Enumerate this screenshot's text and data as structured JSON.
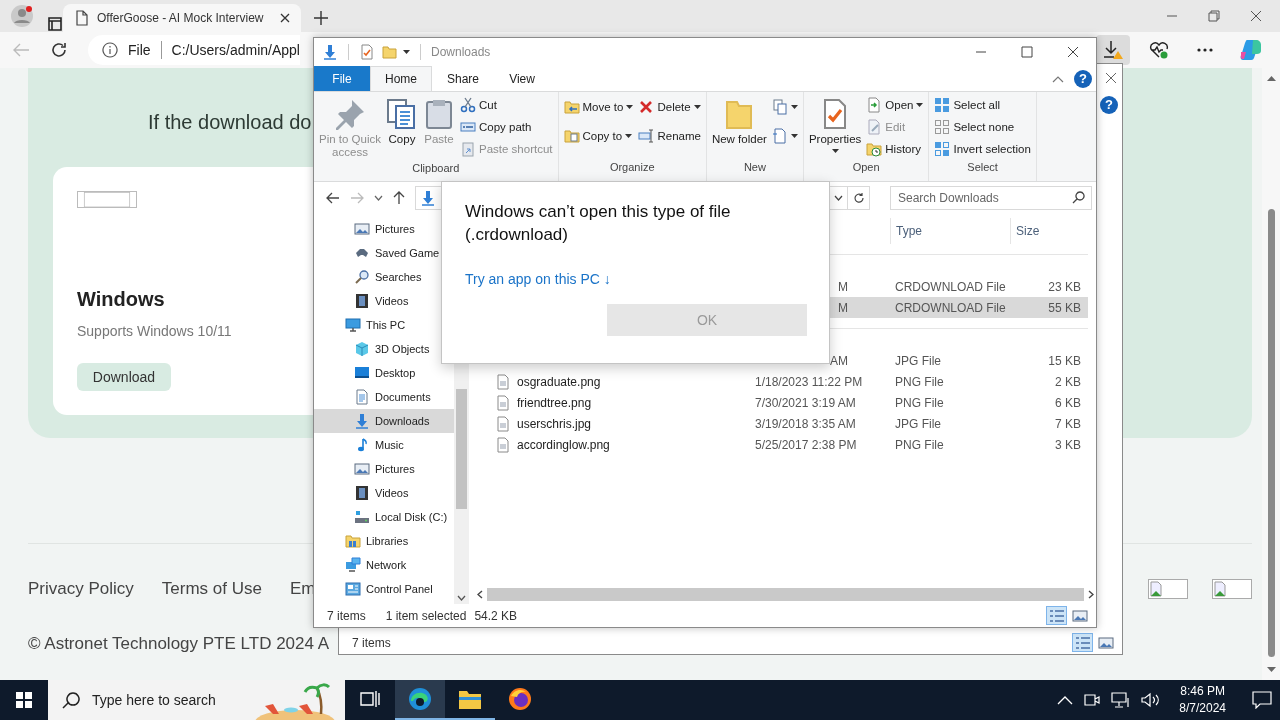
{
  "browser": {
    "tab": {
      "title": "OfferGoose - AI Mock Interview",
      "selected": true
    },
    "address": {
      "scheme": "File",
      "url": "C:/Users/admin/Appl"
    },
    "downloads_button": {
      "selected": true
    }
  },
  "page": {
    "heading": "If the download do",
    "card": {
      "title": "Windows",
      "subtitle": "Supports Windows 10/11",
      "button": "Download"
    },
    "footer_links": [
      "Privacy Policy",
      "Terms of Use",
      "Em"
    ],
    "copyright": "© Astronet Technology PTE LTD 2024 A"
  },
  "back_window": {
    "help": "?",
    "status": "7 items"
  },
  "explorer": {
    "title": "Downloads",
    "help": "?",
    "ribbon_tabs": [
      {
        "label": "File",
        "kind": "file",
        "selected": false
      },
      {
        "label": "Home",
        "kind": "tab",
        "selected": true
      },
      {
        "label": "Share",
        "kind": "tab",
        "selected": false
      },
      {
        "label": "View",
        "kind": "tab",
        "selected": false
      }
    ],
    "ribbon_groups": [
      {
        "label": "Clipboard",
        "columns": [
          [
            {
              "label": "Pin to Quick access",
              "kind": "large",
              "disabled": true
            }
          ],
          [
            {
              "label": "Copy",
              "kind": "large",
              "disabled": false
            }
          ],
          [
            {
              "label": "Paste",
              "kind": "large",
              "disabled": true
            }
          ],
          [
            {
              "label": "Cut",
              "kind": "small",
              "disabled": false
            },
            {
              "label": "Copy path",
              "kind": "small",
              "disabled": false
            },
            {
              "label": "Paste shortcut",
              "kind": "small",
              "disabled": true
            }
          ]
        ]
      },
      {
        "label": "Organize",
        "columns": [
          [
            {
              "label": "Move to",
              "kind": "small",
              "has_menu": true
            },
            {
              "label": "Copy to",
              "kind": "small",
              "has_menu": true
            }
          ],
          [
            {
              "label": "Delete",
              "kind": "small",
              "has_menu": true
            },
            {
              "label": "Rename",
              "kind": "small"
            }
          ]
        ]
      },
      {
        "label": "New",
        "columns": [
          [
            {
              "label": "New folder",
              "kind": "large"
            }
          ],
          [
            {
              "kind": "small",
              "has_menu": true
            },
            {
              "kind": "small",
              "has_menu": true
            }
          ]
        ]
      },
      {
        "label": "Open",
        "columns": [
          [
            {
              "label": "Properties",
              "kind": "large",
              "has_menu": true
            }
          ],
          [
            {
              "label": "Open",
              "kind": "small",
              "has_menu": true
            },
            {
              "label": "Edit",
              "kind": "small",
              "disabled": true
            },
            {
              "label": "History",
              "kind": "small",
              "disabled": false
            }
          ]
        ]
      },
      {
        "label": "Select",
        "columns": [
          [
            {
              "label": "Select all",
              "kind": "small"
            },
            {
              "label": "Select none",
              "kind": "small"
            },
            {
              "label": "Invert selection",
              "kind": "small"
            }
          ]
        ]
      }
    ],
    "search": {
      "placeholder": "Search Downloads"
    },
    "nav": {
      "scrolled_children": [
        {
          "label": "Pictures",
          "selected": false
        },
        {
          "label": "Saved Game",
          "selected": false
        },
        {
          "label": "Searches",
          "selected": false
        },
        {
          "label": "Videos",
          "selected": false
        }
      ],
      "items": [
        {
          "label": "This PC",
          "selected": false,
          "children": [
            {
              "label": "3D Objects",
              "selected": false
            },
            {
              "label": "Desktop",
              "selected": false
            },
            {
              "label": "Documents",
              "selected": false
            },
            {
              "label": "Downloads",
              "selected": true
            },
            {
              "label": "Music",
              "selected": false
            },
            {
              "label": "Pictures",
              "selected": false
            },
            {
              "label": "Videos",
              "selected": false
            },
            {
              "label": "Local Disk (C:)",
              "selected": false
            }
          ]
        },
        {
          "label": "Libraries",
          "selected": false
        },
        {
          "label": "Network",
          "selected": false
        },
        {
          "label": "Control Panel",
          "selected": false
        }
      ]
    },
    "columns": [
      "Type",
      "Size"
    ],
    "rows": [
      {
        "kind": "covered",
        "date": "M",
        "type": "CRDOWNLOAD File",
        "size": "23 KB",
        "selected": false,
        "divider_before": true
      },
      {
        "kind": "covered",
        "date": "M",
        "type": "CRDOWNLOAD File",
        "size": "55 KB",
        "selected": true,
        "divider_before": false
      },
      {
        "kind": "covered",
        "date": "AM",
        "type": "JPG File",
        "size": "15 KB",
        "selected": false,
        "divider_before": true
      },
      {
        "kind": "full",
        "name": "osgraduate.png",
        "date": "1/18/2023 11:22 PM",
        "type": "PNG File",
        "size": "2 KB",
        "selected": false,
        "divider_before": false
      },
      {
        "kind": "full",
        "name": "friendtree.png",
        "date": "7/30/2021 3:19 AM",
        "type": "PNG File",
        "size": "6 KB",
        "selected": false,
        "divider_before": false
      },
      {
        "kind": "full",
        "name": "userschris.jpg",
        "date": "3/19/2018 3:35 AM",
        "type": "JPG File",
        "size": "7 KB",
        "selected": false,
        "divider_before": false
      },
      {
        "kind": "full",
        "name": "accordinglow.png",
        "date": "5/25/2017 2:38 PM",
        "type": "PNG File",
        "size": "3 KB",
        "selected": false,
        "divider_before": false
      }
    ],
    "status": {
      "count": "7 items",
      "selection": "1 item selected",
      "size": "54.2 KB"
    },
    "views": [
      {
        "selected": true
      },
      {
        "selected": false
      }
    ]
  },
  "dialog": {
    "title": "Windows can’t open this type of file (.crdownload)",
    "link": "Try an app on this PC ↓",
    "button": "OK",
    "disabled": true
  },
  "taskbar": {
    "search": {
      "placeholder": "Type here to search"
    },
    "apps": [
      {
        "selected": false,
        "running": false
      },
      {
        "selected": true,
        "running": true
      },
      {
        "selected": false,
        "running": true
      },
      {
        "selected": false,
        "running": false
      }
    ],
    "clock": {
      "time": "8:46 PM",
      "date": "8/7/2024"
    }
  }
}
